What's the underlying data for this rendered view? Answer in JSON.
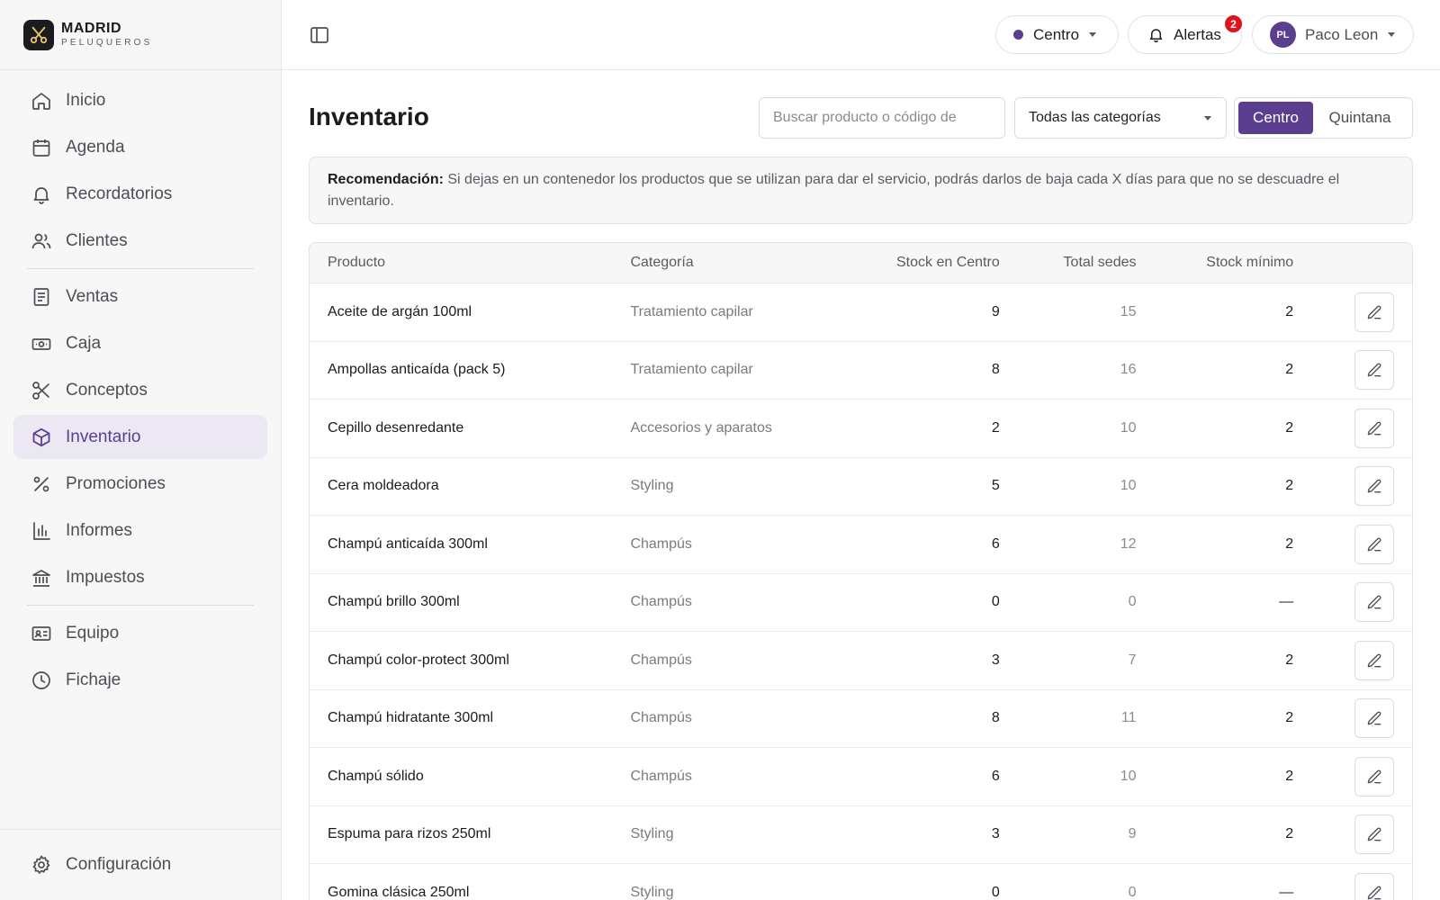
{
  "brand": {
    "name": "MADRID",
    "subtitle": "PELUQUEROS"
  },
  "sidebar": {
    "items": [
      {
        "label": "Inicio",
        "icon": "home-icon"
      },
      {
        "label": "Agenda",
        "icon": "calendar-icon"
      },
      {
        "label": "Recordatorios",
        "icon": "bell-icon"
      },
      {
        "label": "Clientes",
        "icon": "users-icon"
      },
      {
        "label": "Ventas",
        "icon": "receipt-icon"
      },
      {
        "label": "Caja",
        "icon": "cash-icon"
      },
      {
        "label": "Conceptos",
        "icon": "scissors-icon"
      },
      {
        "label": "Inventario",
        "icon": "box-icon",
        "active": true
      },
      {
        "label": "Promociones",
        "icon": "percent-icon"
      },
      {
        "label": "Informes",
        "icon": "bar-chart-icon"
      },
      {
        "label": "Impuestos",
        "icon": "bank-icon"
      },
      {
        "label": "Equipo",
        "icon": "id-card-icon"
      },
      {
        "label": "Fichaje",
        "icon": "clock-icon"
      }
    ],
    "settings": {
      "label": "Configuración",
      "icon": "gear-icon"
    }
  },
  "topbar": {
    "location": "Centro",
    "alerts_label": "Alertas",
    "alerts_count": "2",
    "user_initials": "PL",
    "user_name": "Paco Leon"
  },
  "page": {
    "title": "Inventario",
    "search_placeholder": "Buscar producto o código de",
    "category_filter": "Todas las categorías",
    "sites": [
      "Centro",
      "Quintana"
    ],
    "selected_site": "Centro",
    "recommendation_label": "Recomendación:",
    "recommendation_text": " Si dejas en un contenedor los productos que se utilizan para dar el servicio, podrás darlos de baja cada X días para que no se descuadre el inventario."
  },
  "table": {
    "columns": [
      "Producto",
      "Categoría",
      "Stock en Centro",
      "Total sedes",
      "Stock mínimo"
    ],
    "rows": [
      {
        "product": "Aceite de argán 100ml",
        "category": "Tratamiento capilar",
        "stock": "9",
        "total": "15",
        "min": "2"
      },
      {
        "product": "Ampollas anticaída (pack 5)",
        "category": "Tratamiento capilar",
        "stock": "8",
        "total": "16",
        "min": "2"
      },
      {
        "product": "Cepillo desenredante",
        "category": "Accesorios y aparatos",
        "stock": "2",
        "total": "10",
        "min": "2"
      },
      {
        "product": "Cera moldeadora",
        "category": "Styling",
        "stock": "5",
        "total": "10",
        "min": "2"
      },
      {
        "product": "Champú anticaída 300ml",
        "category": "Champús",
        "stock": "6",
        "total": "12",
        "min": "2"
      },
      {
        "product": "Champú brillo 300ml",
        "category": "Champús",
        "stock": "0",
        "total": "0",
        "min": "—"
      },
      {
        "product": "Champú color-protect 300ml",
        "category": "Champús",
        "stock": "3",
        "total": "7",
        "min": "2"
      },
      {
        "product": "Champú hidratante 300ml",
        "category": "Champús",
        "stock": "8",
        "total": "11",
        "min": "2"
      },
      {
        "product": "Champú sólido",
        "category": "Champús",
        "stock": "6",
        "total": "10",
        "min": "2"
      },
      {
        "product": "Espuma para rizos 250ml",
        "category": "Styling",
        "stock": "3",
        "total": "9",
        "min": "2"
      },
      {
        "product": "Gomina clásica 250ml",
        "category": "Styling",
        "stock": "0",
        "total": "0",
        "min": "—"
      }
    ]
  },
  "colors": {
    "accent": "#5b3e8f",
    "accent_soft": "#ebe7f3",
    "alert": "#e0131b"
  }
}
